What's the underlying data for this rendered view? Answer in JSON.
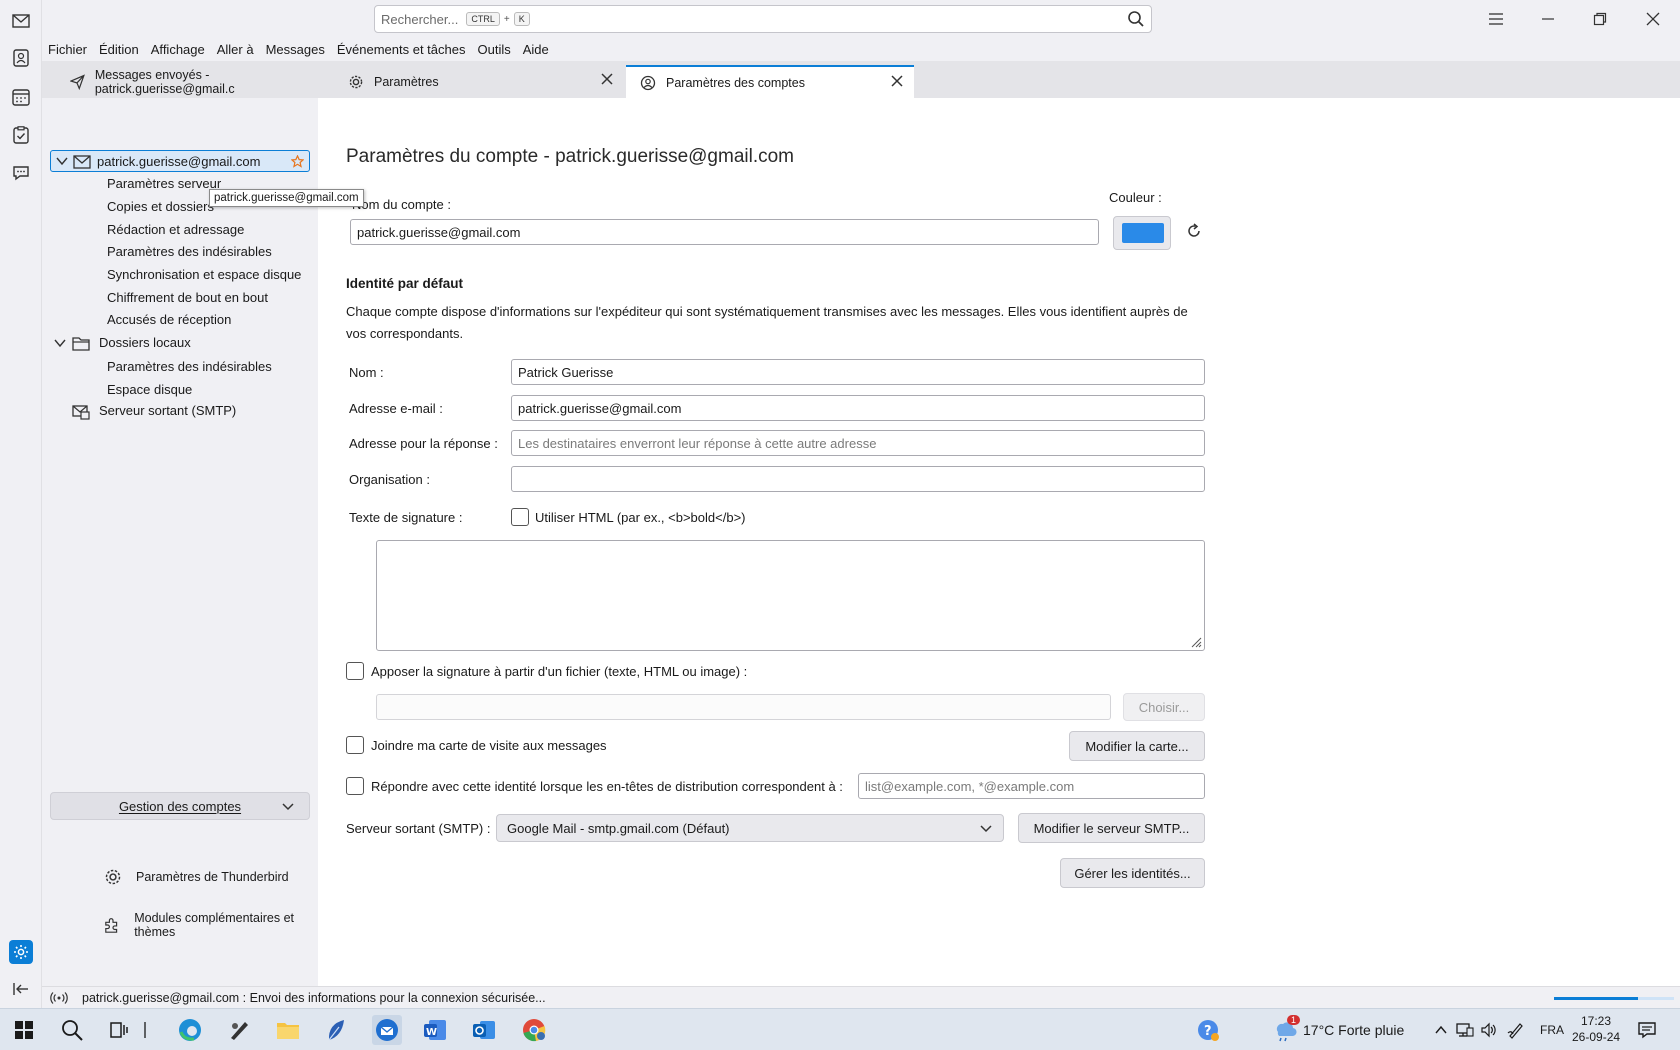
{
  "search": {
    "placeholder": "Rechercher...",
    "kbd1": "CTRL",
    "plus": "+",
    "kbd2": "K"
  },
  "menu": [
    "Fichier",
    "Édition",
    "Affichage",
    "Aller à",
    "Messages",
    "Événements et tâches",
    "Outils",
    "Aide"
  ],
  "tabs": [
    {
      "label": "Messages envoyés - patrick.guerisse@gmail.c",
      "icon": "paper-plane-icon"
    },
    {
      "label": "Paramètres",
      "icon": "gear-icon"
    },
    {
      "label": "Paramètres des comptes",
      "icon": "account-settings-icon"
    }
  ],
  "tree": {
    "account": "patrick.guerisse@gmail.com",
    "account_items": [
      "Paramètres serveur",
      "Copies et dossiers",
      "Rédaction et adressage",
      "Paramètres des indésirables",
      "Synchronisation et espace disque",
      "Chiffrement de bout en bout",
      "Accusés de réception"
    ],
    "local": "Dossiers locaux",
    "local_items": [
      "Paramètres des indésirables",
      "Espace disque"
    ],
    "smtp": "Serveur sortant (SMTP)",
    "tooltip": "patrick.guerisse@gmail.com"
  },
  "sidebar_bottom": {
    "mgmt": "Gestion des comptes",
    "tb_settings": "Paramètres de Thunderbird",
    "addons": "Modules complémentaires et thèmes"
  },
  "form": {
    "title": "Paramètres du compte - patrick.guerisse@gmail.com",
    "account_name_label": "Nom du compte :",
    "account_name_value": "patrick.guerisse@gmail.com",
    "color_label": "Couleur :",
    "color_value": "#2a8ae8",
    "section_title": "Identité par défaut",
    "description": "Chaque compte dispose d'informations sur l'expéditeur qui sont systématiquement transmises avec les messages. Elles vous identifient auprès de vos correspondants.",
    "name_label": "Nom :",
    "name_value": "Patrick Guerisse",
    "email_label": "Adresse e-mail :",
    "email_value": "patrick.guerisse@gmail.com",
    "reply_label": "Adresse pour la réponse :",
    "reply_placeholder": "Les destinataires enverront leur réponse à cette autre adresse",
    "org_label": "Organisation :",
    "org_value": "",
    "sig_label": "Texte de signature :",
    "sig_html_label": "Utiliser HTML (par ex., <b>bold</b>)",
    "sig_file_label": "Apposer la signature à partir d'un fichier (texte, HTML ou image) :",
    "choose_btn": "Choisir...",
    "vcard_label": "Joindre ma carte de visite aux messages",
    "vcard_btn": "Modifier la carte...",
    "reply_match_label": "Répondre avec cette identité lorsque les en-têtes de distribution correspondent à :",
    "reply_match_placeholder": "list@example.com, *@example.com",
    "smtp_label": "Serveur sortant (SMTP) :",
    "smtp_value": "Google Mail - smtp.gmail.com (Défaut)",
    "smtp_btn": "Modifier le serveur SMTP...",
    "identities_btn": "Gérer les identités..."
  },
  "status": {
    "text": "patrick.guerisse@gmail.com : Envoi des informations pour la connexion sécurisée..."
  },
  "taskbar": {
    "weather": "17°C  Forte pluie",
    "lang": "FRA",
    "time": "17:23",
    "date": "26-09-24",
    "badge": "1"
  }
}
